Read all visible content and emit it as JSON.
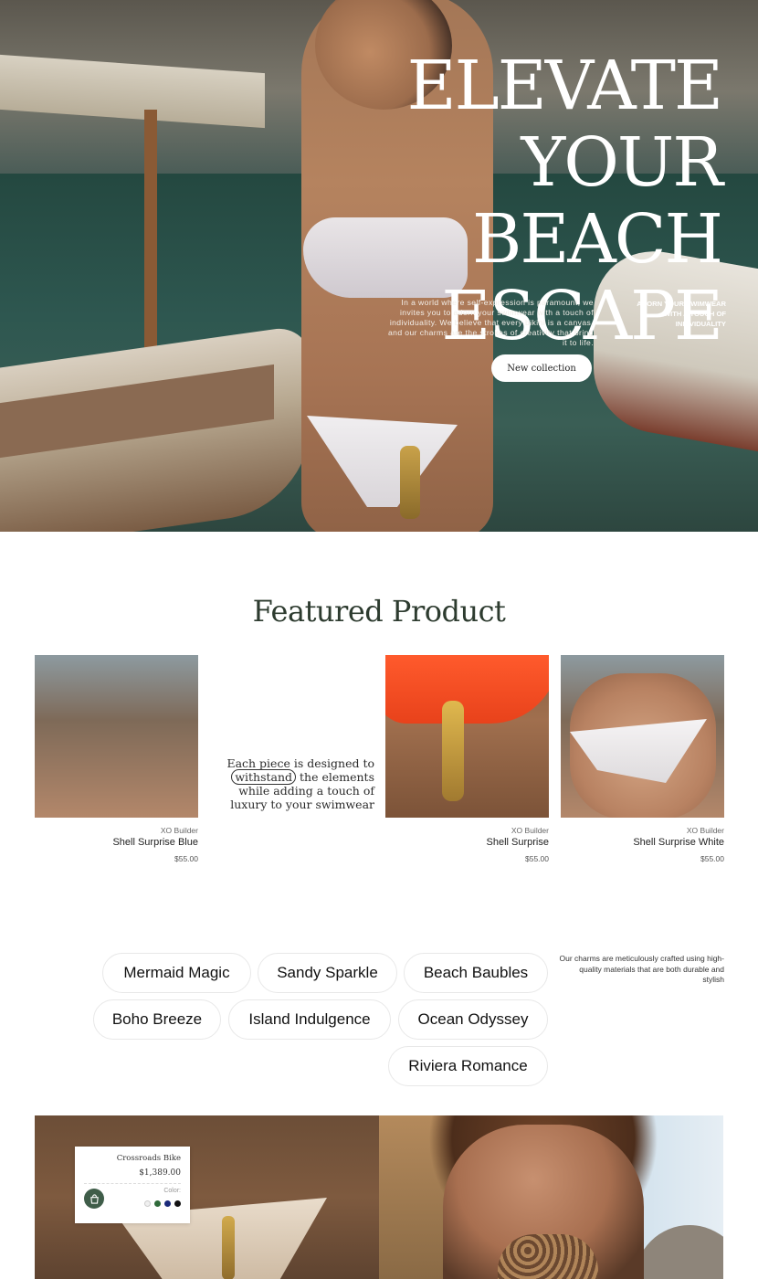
{
  "hero": {
    "title": "Elevate your beach escape",
    "blurb": "In a world where self-expression is paramount, we invites you to adorn your swimwear with a touch of individuality. We believe that every bikini is a canvas, and our charms are the strokes of creativity that bring it to life.",
    "side_text": "Adorn your swimwear with a touch of individuality",
    "cta_label": "New collection"
  },
  "featured": {
    "title": "Featured Product",
    "note_before": "Each piece is designed to ",
    "note_circled": "withstand",
    "note_after": " the elements while adding a touch of luxury to your swimwear",
    "products": [
      {
        "brand": "XO Builder",
        "name": "Shell Surprise White",
        "price": "$55.00"
      },
      {
        "brand": "XO Builder",
        "name": "Shell Surprise",
        "price": "$55.00"
      },
      {
        "brand": "XO Builder",
        "name": "Shell Surprise Blue",
        "price": "$55.00"
      }
    ]
  },
  "categories": {
    "note": "Our charms are meticulously crafted using high-quality materials that are both durable and stylish",
    "chips": [
      "Beach Baubles",
      "Sandy Sparkle",
      "Mermaid Magic",
      "Ocean Odyssey",
      "Island Indulgence",
      "Boho Breeze",
      "Riviera Romance"
    ]
  },
  "quick_card": {
    "name": "Crossroads Bike",
    "price": "$1,389.00",
    "color_label": "Color:",
    "swatches": [
      "#111111",
      "#1a2a7a",
      "#2f6a3a",
      "#f0f0f0"
    ],
    "cart_icon": "shopping-bag-icon"
  },
  "colors": {
    "accent_green": "#3f5d49",
    "title_green": "#2d3b2f"
  }
}
